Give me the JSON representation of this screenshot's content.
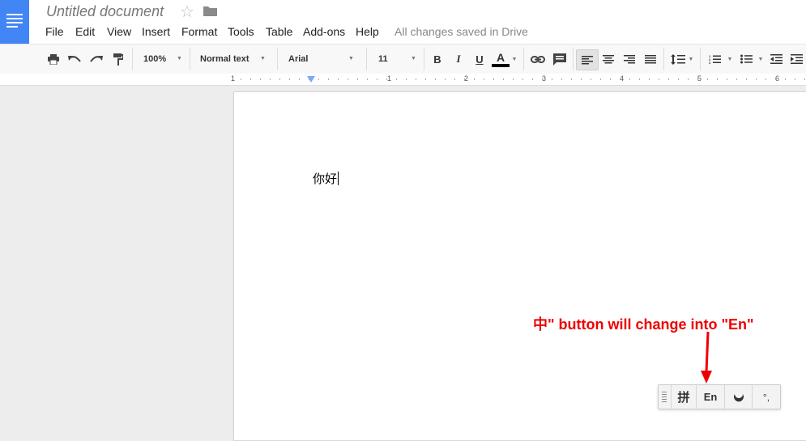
{
  "document": {
    "title": "Untitled document",
    "star_glyph": "☆",
    "body_text": "你好"
  },
  "menu": {
    "items": [
      "File",
      "Edit",
      "View",
      "Insert",
      "Format",
      "Tools",
      "Table",
      "Add-ons",
      "Help"
    ],
    "status": "All changes saved in Drive"
  },
  "toolbar": {
    "zoom": "100%",
    "style": "Normal text",
    "font": "Arial",
    "font_size": "11",
    "bold": "B",
    "italic": "I",
    "underline": "U",
    "text_color_letter": "A",
    "text_color": "#000000"
  },
  "ruler": {
    "labels": [
      "1",
      "1",
      "2",
      "3",
      "4",
      "5",
      "6"
    ]
  },
  "annotation": {
    "text": "中\" button will change into \"En\"",
    "color": "#ee0000"
  },
  "ime": {
    "pinyin_label": "拼",
    "lang_label": "En",
    "moon_glyph": "◡",
    "punct_label": "°,"
  },
  "colors": {
    "docs_blue": "#4285f4",
    "page_bg": "#ededed"
  }
}
